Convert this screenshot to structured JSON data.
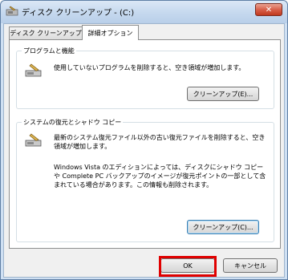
{
  "window": {
    "title": "ディスク クリーンアップ - (C:)",
    "close_symbol": "✕"
  },
  "tabs": [
    {
      "label": "ディスク クリーンアップ",
      "active": false
    },
    {
      "label": "詳細オプション",
      "active": true
    }
  ],
  "groups": {
    "programs": {
      "title": "プログラムと機能",
      "description": "使用していないプログラムを削除すると、空き領域が増加します。",
      "button": "クリーンアップ(E)..."
    },
    "restore": {
      "title": "システムの復元とシャドウ コピー",
      "description_1": "最新のシステム復元ファイル以外の古い復元ファイルを削除すると、空き領域が増加します。",
      "description_2": "Windows Vista のエディションによっては、ディスクにシャドウ コピーや Complete PC バックアップのイメージが復元ポイントの一部として含まれている場合があります。この情報も削除されます。",
      "button": "クリーンアップ(C)..."
    }
  },
  "footer": {
    "ok_label": "OK",
    "cancel_label": "キャンセル"
  },
  "colors": {
    "highlight": "#e00000",
    "titlebar": "#c5d8ee"
  }
}
